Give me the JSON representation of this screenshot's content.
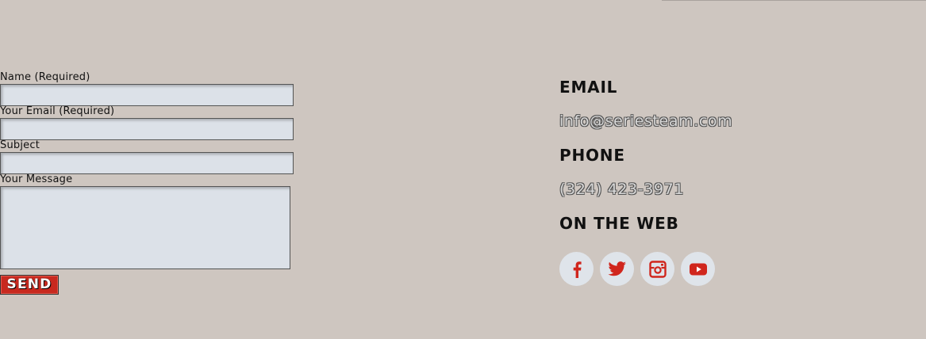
{
  "form": {
    "name_label": "Name (Required)",
    "email_label": "Your Email (Required)",
    "subject_label": "Subject",
    "message_label": "Your Message",
    "name_value": "",
    "email_value": "",
    "subject_value": "",
    "message_value": "",
    "send_label": "SEND"
  },
  "contact": {
    "email_heading": "EMAIL",
    "email_value": "info@seriesteam.com",
    "phone_heading": "PHONE",
    "phone_value": "(324) 423-3971",
    "web_heading": "ON THE WEB"
  },
  "socials": [
    {
      "icon": "facebook-icon"
    },
    {
      "icon": "twitter-icon"
    },
    {
      "icon": "instagram-icon"
    },
    {
      "icon": "youtube-icon"
    }
  ],
  "colors": {
    "background": "#cec6c0",
    "accent": "#c8291f",
    "field_bg": "#dce1e8",
    "social_bg": "#dfe4ea",
    "social_icon": "#d0261d"
  }
}
